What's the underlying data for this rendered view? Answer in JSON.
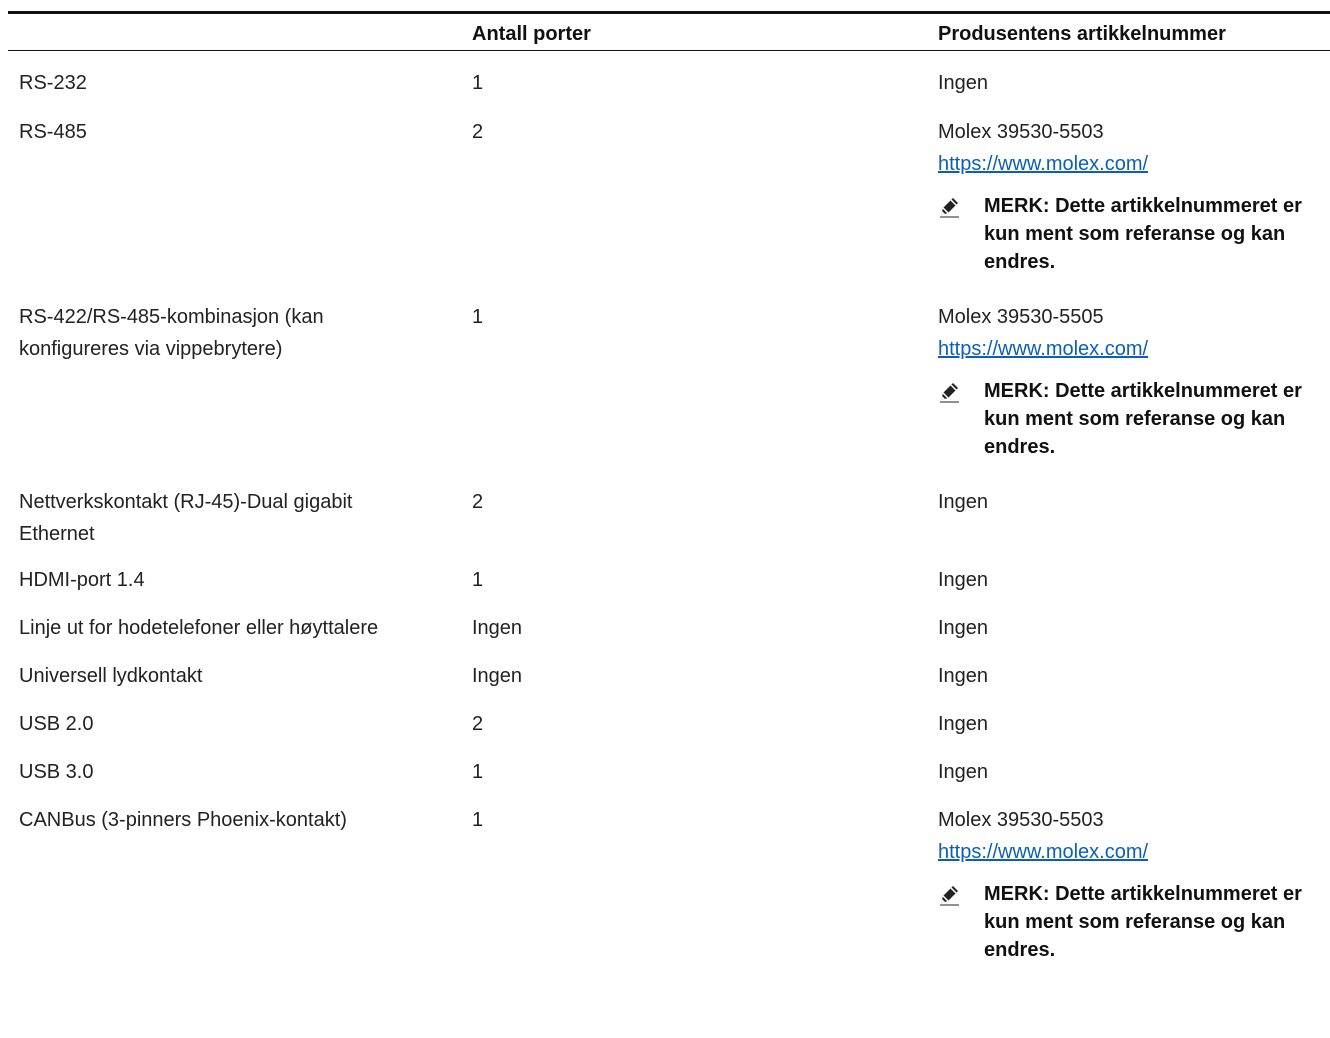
{
  "header": {
    "col1": "",
    "col2": "Antall porter",
    "col3": "Produsentens artikkelnummer"
  },
  "rows": [
    {
      "name": "RS-232",
      "ports": "1",
      "part": "Ingen"
    },
    {
      "name": "RS-485",
      "ports": "2",
      "part": "Molex 39530-5503",
      "link": "https://www.molex.com/",
      "note": "MERK: Dette artikkelnummeret er kun ment som referanse og kan endres."
    },
    {
      "name": "RS-422/RS-485-kombinasjon (kan konfigureres via vippebrytere)",
      "ports": "1",
      "part": "Molex 39530-5505",
      "link": "https://www.molex.com/",
      "note": "MERK: Dette artikkelnummeret er kun ment som referanse og kan endres."
    },
    {
      "name": "Nettverkskontakt (RJ-45)-Dual gigabit Ethernet",
      "ports": "2",
      "part": "Ingen"
    },
    {
      "name": "HDMI-port 1.4",
      "ports": "1",
      "part": "Ingen"
    },
    {
      "name": "Linje ut for hodetelefoner eller høyttalere",
      "ports": "Ingen",
      "part": "Ingen"
    },
    {
      "name": "Universell lydkontakt",
      "ports": "Ingen",
      "part": "Ingen"
    },
    {
      "name": "USB 2.0",
      "ports": "2",
      "part": "Ingen"
    },
    {
      "name": "USB 3.0",
      "ports": "1",
      "part": "Ingen"
    },
    {
      "name": "CANBus (3-pinners Phoenix-kontakt)",
      "ports": "1",
      "part": "Molex 39530-5503",
      "link": "https://www.molex.com/",
      "note": "MERK: Dette artikkelnummeret er kun ment som referanse og kan endres."
    }
  ],
  "icons": {
    "note": "pencil-note-icon"
  },
  "colors": {
    "link": "#0b5fb8",
    "text": "#222222",
    "rule": "#111111"
  }
}
